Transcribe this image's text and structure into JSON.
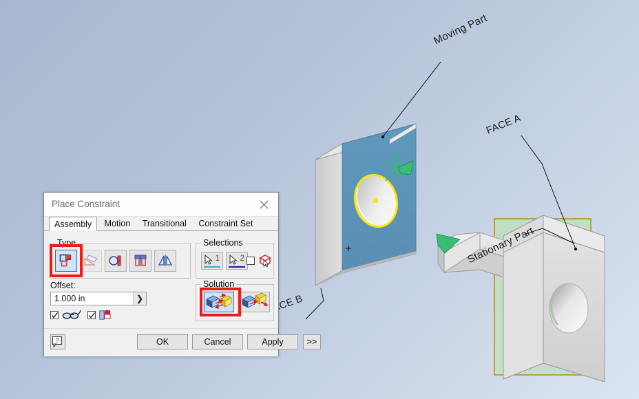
{
  "scene": {
    "background_top_color": "#a9b8d0",
    "background_bottom_color": "#dbe4f0",
    "annotations": [
      {
        "id": "moving-part",
        "text": "Moving Part"
      },
      {
        "id": "face-a",
        "text": "FACE A"
      },
      {
        "id": "stationary-part",
        "text": "Stationary Part"
      },
      {
        "id": "face-b",
        "text": "FACE B"
      }
    ],
    "moving_part": {
      "face_highlight_color": "#5b92b8",
      "hole_outline_color": "#ffe800",
      "body_color": "#d8d8d8",
      "axis_marker_color": "#2fbf6a"
    },
    "stationary_part": {
      "face_plane_color": "#bfe0b8",
      "face_plane_border_color": "#b08a1e",
      "body_color": "#d6d6d6",
      "axis_marker_color": "#2fbf6a"
    }
  },
  "dialog": {
    "title": "Place Constraint",
    "close_label": "✕",
    "tabs": [
      {
        "label": "Assembly",
        "active": true
      },
      {
        "label": "Motion",
        "active": false
      },
      {
        "label": "Transitional",
        "active": false
      },
      {
        "label": "Constraint Set",
        "active": false
      }
    ],
    "type_group": {
      "legend": "Type",
      "buttons": [
        {
          "name": "mate",
          "selected": true,
          "disabled": false
        },
        {
          "name": "angle",
          "selected": false,
          "disabled": true
        },
        {
          "name": "tangent",
          "selected": false,
          "disabled": false
        },
        {
          "name": "insert",
          "selected": false,
          "disabled": false
        },
        {
          "name": "symmetry",
          "selected": false,
          "disabled": false
        }
      ]
    },
    "selections_group": {
      "legend": "Selections",
      "buttons": [
        {
          "number": "1",
          "underline_color": "#2aaee0"
        },
        {
          "number": "2",
          "underline_color": "#1a1ab0"
        }
      ],
      "checkbox_checked": false,
      "pick_part_first_icon": "pick-part-first-icon"
    },
    "offset": {
      "label": "Offset:",
      "value": "1.000 in",
      "dropdown_glyph": "❯"
    },
    "options": [
      {
        "name": "show-preview",
        "checked": true,
        "icon": "glasses-icon"
      },
      {
        "name": "predict-offset",
        "checked": true,
        "icon": "predict-offset-icon"
      }
    ],
    "solution_group": {
      "legend": "Solution",
      "buttons": [
        {
          "name": "mate-solution",
          "selected": true
        },
        {
          "name": "flush-solution",
          "selected": false
        }
      ]
    },
    "footer": {
      "help_label": "?",
      "ok_label": "OK",
      "cancel_label": "Cancel",
      "apply_label": "Apply",
      "more_label": ">>"
    },
    "highlight_color": "#ee1b1b"
  }
}
